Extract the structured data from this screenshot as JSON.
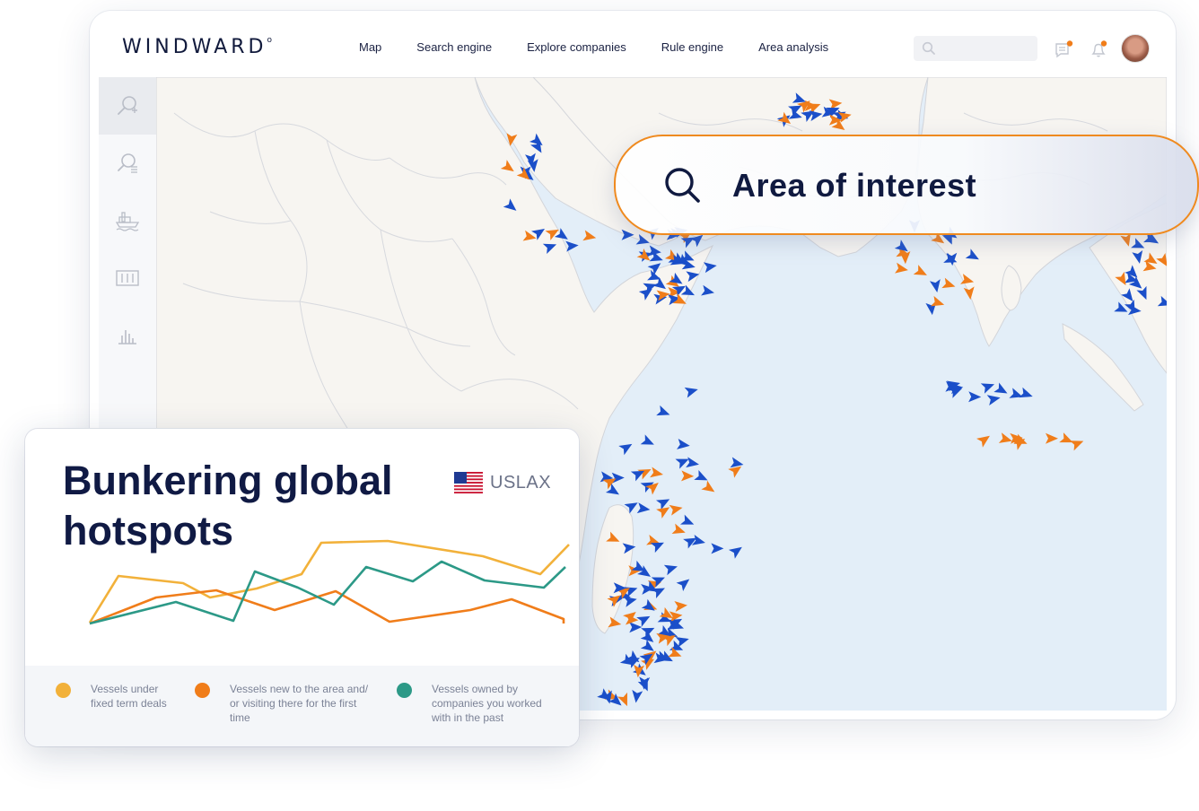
{
  "app": {
    "logo": "WINDWARD",
    "logo_mark": "o"
  },
  "nav": [
    "Map",
    "Search engine",
    "Explore companies",
    "Rule engine",
    "Area analysis"
  ],
  "search": {
    "placeholder": "",
    "icon": "search-icon"
  },
  "toolbar_icons": [
    "messages-icon",
    "bell-icon"
  ],
  "notification_color": "#f07d1a",
  "sidebar_icons": [
    "search-plus-icon",
    "search-list-icon",
    "ship-port-icon",
    "columns-icon",
    "bar-chart-icon"
  ],
  "area_of_interest": {
    "label": "Area of interest",
    "icon": "search-icon"
  },
  "vessel_colors": {
    "blue": "#1b4fc9",
    "orange": "#f07d1a",
    "yellow": "#f2b13a"
  },
  "card": {
    "title_line1": "Bunkering global",
    "title_line2": "hotspots",
    "port_code": "USLAX",
    "flag": "us-flag-icon"
  },
  "chart_data": {
    "type": "line",
    "title": "",
    "xlabel": "",
    "ylabel": "",
    "x": [
      1,
      2,
      3,
      4,
      5,
      6,
      7,
      8,
      9,
      10,
      11,
      12,
      13,
      14,
      15,
      16,
      17,
      18,
      19,
      20,
      21
    ],
    "series": [
      {
        "name": "Vessels under fixed term deals",
        "color": "#f2b13a",
        "x": [
          1,
          2,
          3,
          4,
          5,
          6,
          7,
          8,
          9,
          10,
          11
        ],
        "values": [
          16,
          68,
          60,
          44,
          54,
          70,
          105,
          107,
          90,
          70,
          103
        ]
      },
      {
        "name": "Vessels new to the area and/ or visiting there for the first time",
        "color": "#f07d1a",
        "x": [
          1,
          2,
          3,
          4,
          5,
          6,
          7,
          8,
          9,
          10
        ],
        "values": [
          15,
          44,
          52,
          30,
          51,
          17,
          30,
          42,
          20,
          15
        ]
      },
      {
        "name": "Vessels owned by companies you worked with in the past",
        "color": "#2c9987",
        "x": [
          1,
          2,
          3,
          4,
          5,
          6,
          7,
          8,
          9,
          10,
          11,
          12
        ],
        "values": [
          15,
          39,
          18,
          73,
          55,
          36,
          78,
          62,
          84,
          63,
          55,
          78
        ]
      }
    ],
    "xlim": [
      1,
      21
    ],
    "ylim": [
      0,
      115
    ],
    "grid": false,
    "legend": "bottom"
  }
}
